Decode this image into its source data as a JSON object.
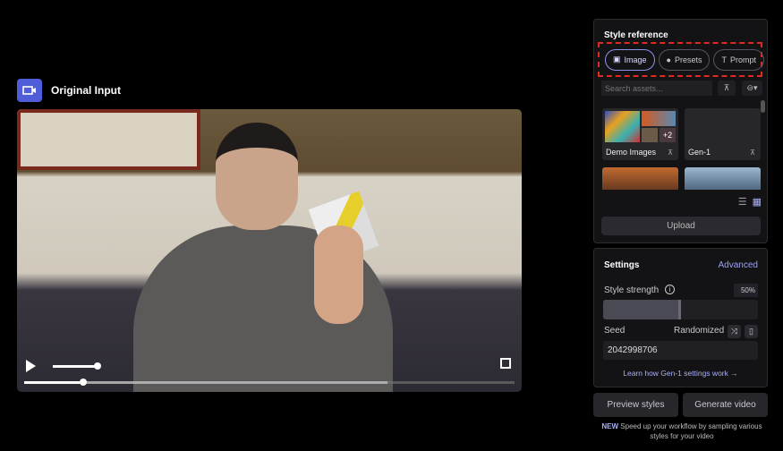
{
  "header": {
    "title": "Original Input",
    "icon": "video-camera-icon",
    "accent": "#4f5ed8"
  },
  "player": {
    "progress_percent": 12,
    "buffered_percent": 74,
    "volume_percent": 100
  },
  "style_reference": {
    "title": "Style reference",
    "tabs": [
      {
        "label": "Image",
        "icon": "image-icon",
        "active": true
      },
      {
        "label": "Presets",
        "icon": "drop-icon"
      },
      {
        "label": "Prompt",
        "icon": "text-icon"
      }
    ],
    "search_placeholder": "Search assets...",
    "folders": [
      {
        "label": "Demo Images",
        "badge": "+2"
      },
      {
        "label": "Gen-1"
      }
    ],
    "upload_label": "Upload"
  },
  "settings": {
    "title": "Settings",
    "advanced_label": "Advanced",
    "style_strength_label": "Style strength",
    "style_strength_value": "50%",
    "style_strength": 50,
    "seed_label": "Seed",
    "randomized_label": "Randomized",
    "seed_value": "2042998706",
    "learn_link": "Learn how Gen-1 settings work →"
  },
  "actions": {
    "preview": "Preview styles",
    "generate": "Generate video"
  },
  "note": {
    "badge": "NEW",
    "text": " Speed up your workflow by sampling various styles for your video"
  }
}
